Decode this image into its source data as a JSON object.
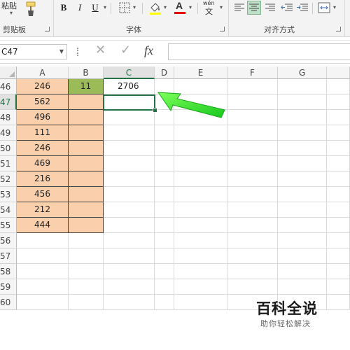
{
  "ribbon": {
    "paste_label": "粘贴",
    "clipboard_group": "剪贴板",
    "font_group": "字体",
    "align_group": "对齐方式",
    "bold": "B",
    "italic": "I",
    "underline": "U",
    "font_color_glyph": "A",
    "phonetic_top": "wén",
    "phonetic_bottom": "文"
  },
  "formula_bar": {
    "name_box": "C47",
    "fx": "fx",
    "cancel": "✕",
    "enter": "✓",
    "formula": ""
  },
  "columns": [
    "A",
    "B",
    "C",
    "D",
    "E",
    "F",
    "G"
  ],
  "selected_column": "C",
  "rows": [
    "46",
    "47",
    "48",
    "49",
    "50",
    "51",
    "52",
    "53",
    "54",
    "55",
    "56",
    "57",
    "58",
    "59",
    "60"
  ],
  "selected_row": "47",
  "cells": {
    "A46": "246",
    "B46": "11",
    "C46": "2706",
    "A47": "562",
    "A48": "496",
    "A49": "111",
    "A50": "246",
    "A51": "469",
    "A52": "216",
    "A53": "456",
    "A54": "212",
    "A55": "444"
  },
  "colors": {
    "range_fill": "#f9cfac",
    "b46_fill": "#9bbb59",
    "arrow": "#22dd22",
    "selection": "#217346"
  },
  "watermark": {
    "title": "百科全说",
    "subtitle": "助你轻松解决"
  }
}
